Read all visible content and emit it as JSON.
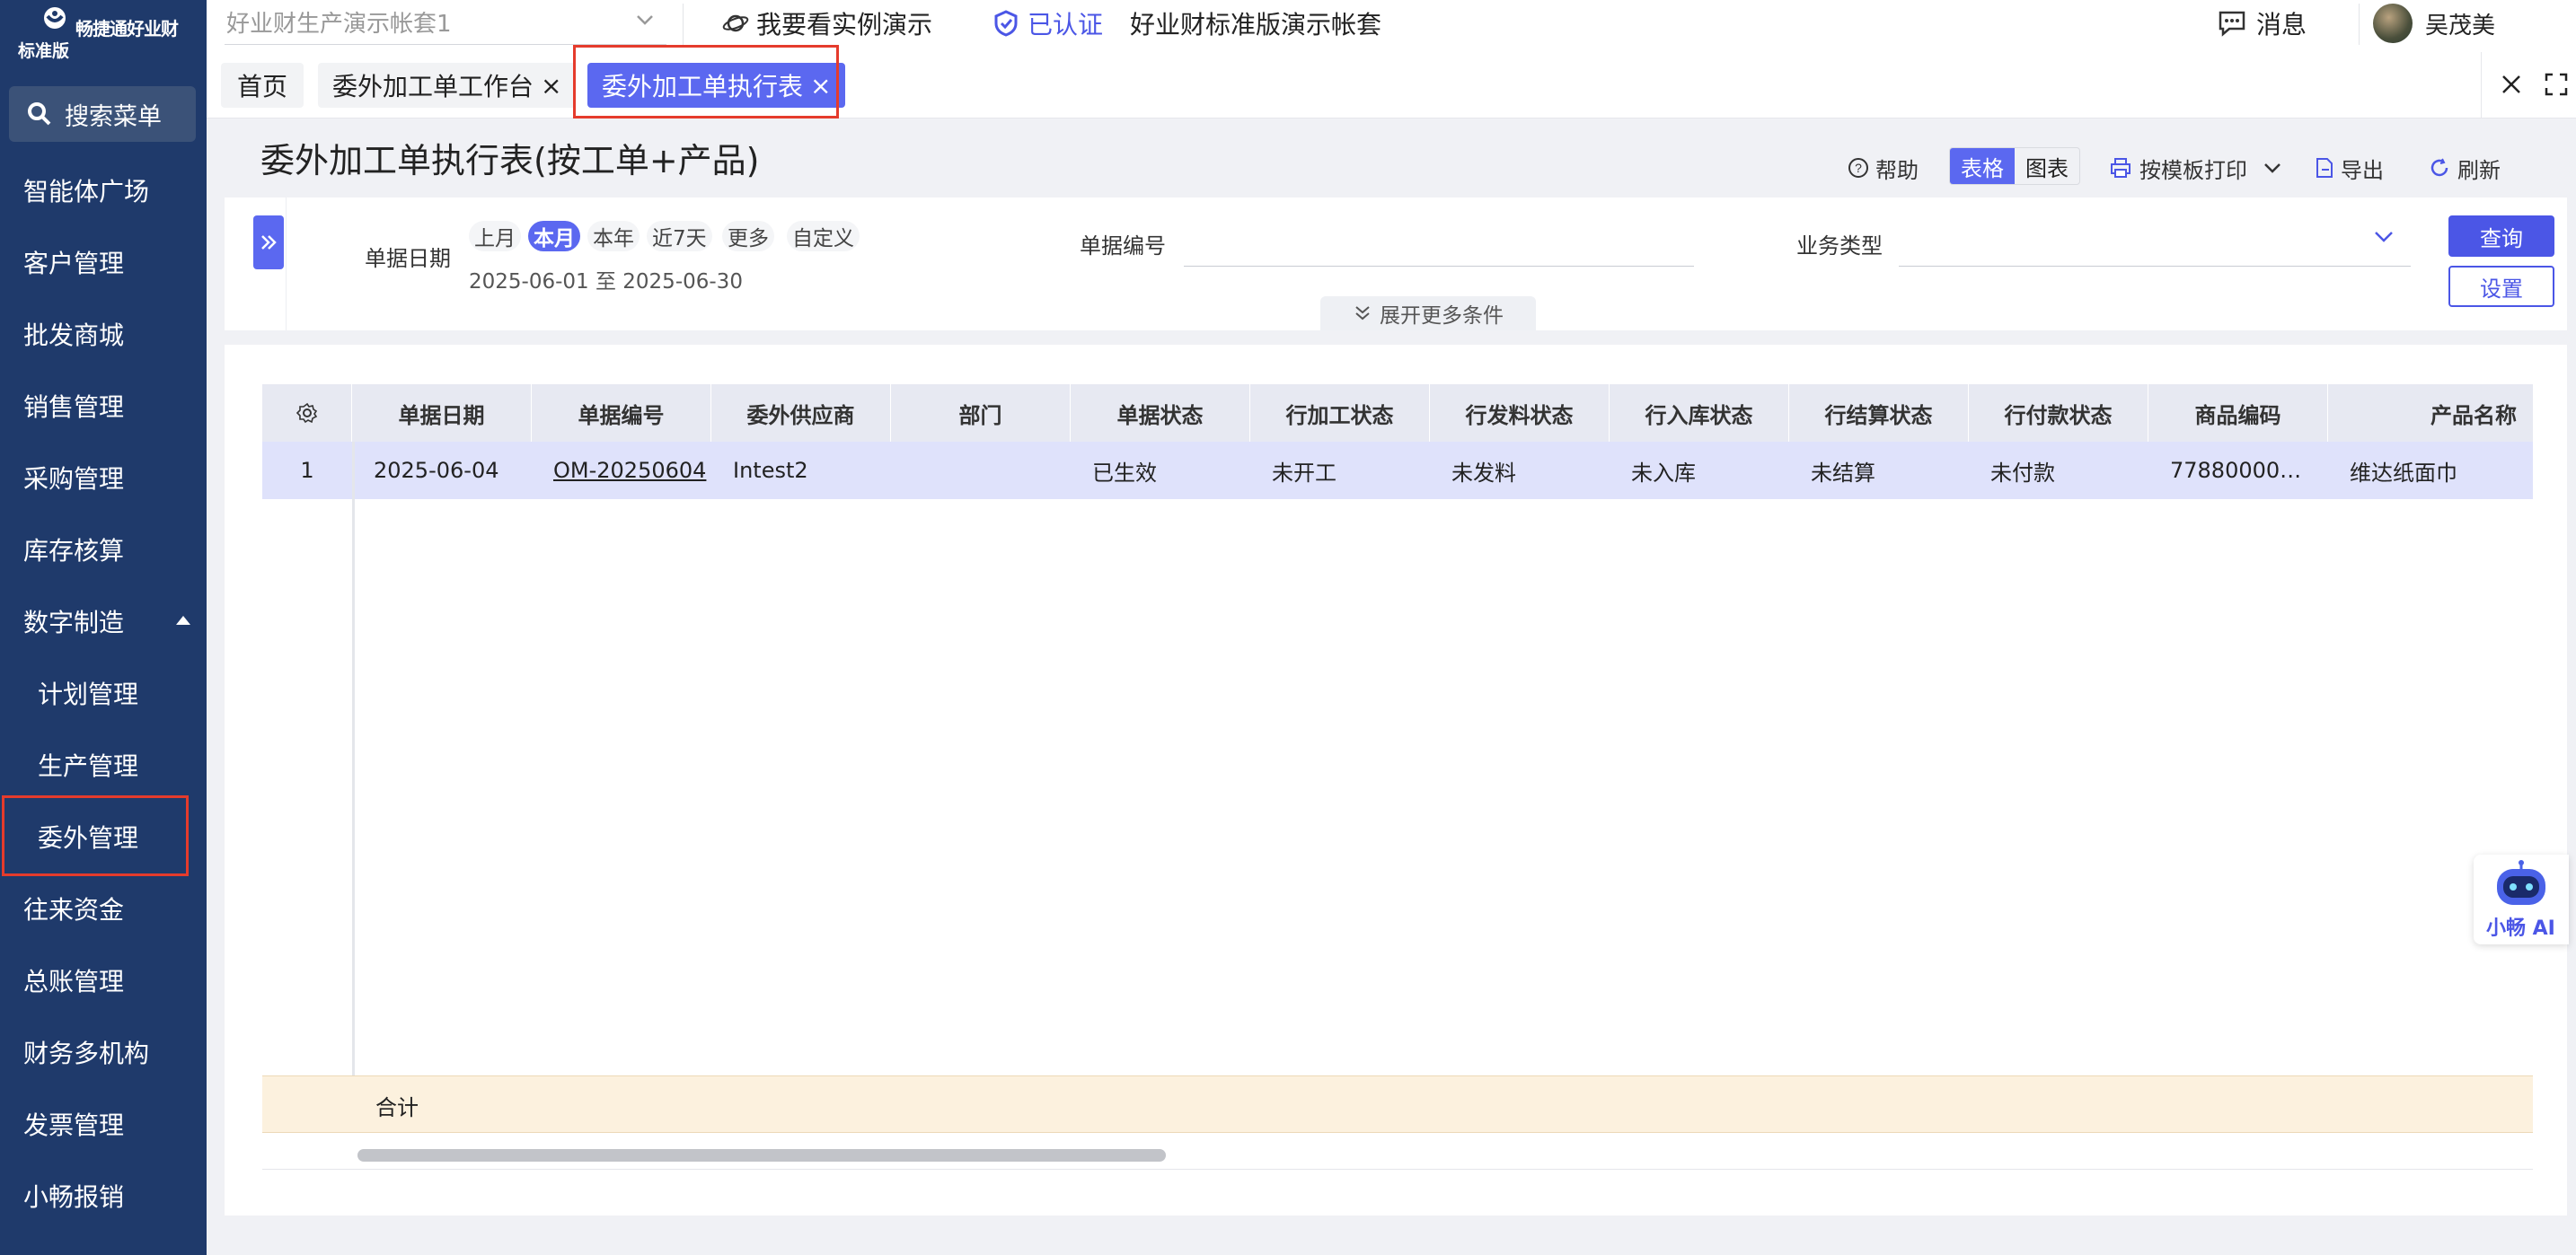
{
  "brand": {
    "name": "畅捷通好业财",
    "edition": "标准版"
  },
  "sidebar": {
    "search_label": "搜索菜单",
    "items": [
      {
        "label": "智能体广场"
      },
      {
        "label": "客户管理"
      },
      {
        "label": "批发商城"
      },
      {
        "label": "销售管理"
      },
      {
        "label": "采购管理"
      },
      {
        "label": "库存核算"
      },
      {
        "label": "数字制造"
      },
      {
        "label": "计划管理"
      },
      {
        "label": "生产管理"
      },
      {
        "label": "委外管理"
      },
      {
        "label": "往来资金"
      },
      {
        "label": "总账管理"
      },
      {
        "label": "财务多机构"
      },
      {
        "label": "发票管理"
      },
      {
        "label": "小畅报销"
      }
    ]
  },
  "topbar": {
    "account_select": "好业财生产演示帐套1",
    "demo_link": "我要看实例演示",
    "certified": "已认证",
    "account_name": "好业财标准版演示帐套",
    "messages": "消息",
    "user_name": "吴茂美"
  },
  "tabs": [
    {
      "label": "首页"
    },
    {
      "label": "委外加工单工作台",
      "close": "×"
    },
    {
      "label": "委外加工单执行表",
      "close": "×"
    }
  ],
  "page": {
    "title": "委外加工单执行表(按工单+产品)",
    "help": "帮助",
    "view_table": "表格",
    "view_chart": "图表",
    "print": "按模板打印",
    "export": "导出",
    "refresh": "刷新"
  },
  "filter": {
    "date_label": "单据日期",
    "date_chips": [
      "上月",
      "本月",
      "本年",
      "近7天",
      "更多",
      "自定义"
    ],
    "date_range": "2025-06-01 至 2025-06-30",
    "doc_no_label": "单据编号",
    "doc_no_value": "",
    "biz_type_label": "业务类型",
    "biz_type_value": "",
    "query": "查询",
    "settings": "设置",
    "more_conditions": "展开更多条件"
  },
  "table": {
    "columns": [
      "单据日期",
      "单据编号",
      "委外供应商",
      "部门",
      "单据状态",
      "行加工状态",
      "行发料状态",
      "行入库状态",
      "行结算状态",
      "行付款状态",
      "商品编码",
      "产品名称"
    ],
    "rows": [
      {
        "index": "1",
        "cells": [
          "2025-06-04",
          "OM-20250604",
          "Intest2",
          "",
          "已生效",
          "未开工",
          "未发料",
          "未入库",
          "未结算",
          "未付款",
          "77880000…",
          "维达纸面巾"
        ]
      }
    ],
    "total_label": "合计"
  },
  "ai": {
    "label": "小畅 AI"
  },
  "colors": {
    "sidebar": "#1f3a6b",
    "accent": "#5b68f0",
    "highlight": "#e53b2c",
    "row_selected": "#dfe2fb",
    "total_row": "#fcf1de"
  }
}
